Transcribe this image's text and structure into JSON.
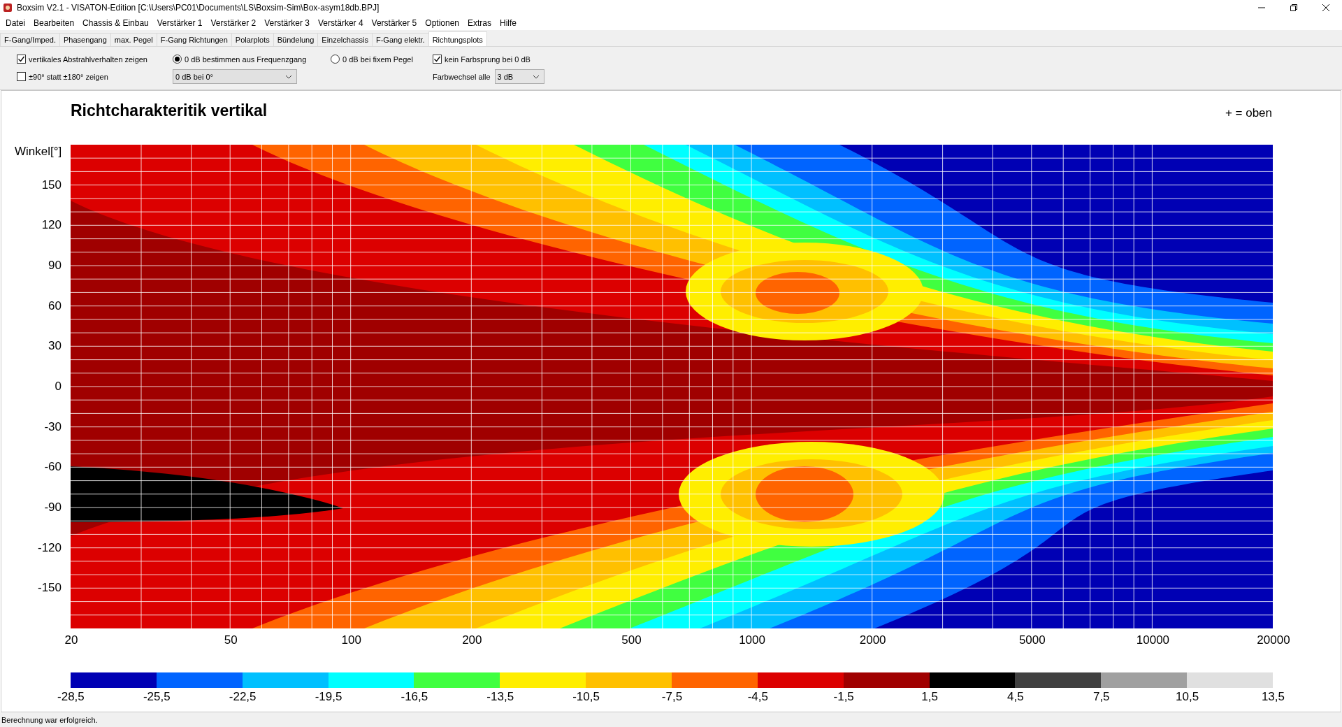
{
  "window": {
    "title": "Boxsim V2.1 - VISATON-Edition [C:\\Users\\PC01\\Documents\\LS\\Boxsim-Sim\\Box-asym18db.BPJ]"
  },
  "menu": [
    "Datei",
    "Bearbeiten",
    "Chassis & Einbau",
    "Verstärker 1",
    "Verstärker 2",
    "Verstärker 3",
    "Verstärker 4",
    "Verstärker 5",
    "Optionen",
    "Extras",
    "Hilfe"
  ],
  "tabs": [
    {
      "label": "F-Gang/Imped.",
      "selected": false
    },
    {
      "label": "Phasengang",
      "selected": false
    },
    {
      "label": "max. Pegel",
      "selected": false
    },
    {
      "label": "F-Gang Richtungen",
      "selected": false
    },
    {
      "label": "Polarplots",
      "selected": false
    },
    {
      "label": "Bündelung",
      "selected": false
    },
    {
      "label": "Einzelchassis",
      "selected": false
    },
    {
      "label": "F-Gang elektr.",
      "selected": false
    },
    {
      "label": "Richtungsplots",
      "selected": true
    }
  ],
  "options": [
    {
      "kind": "checkbox",
      "label": "vertikales Abstrahlverhalten zeigen",
      "checked": true
    },
    {
      "kind": "radio",
      "label": "0 dB bestimmen aus Frequenzgang",
      "selected": true
    },
    {
      "kind": "radio",
      "label": "0 dB bei fixem Pegel",
      "selected": false
    },
    {
      "kind": "checkbox",
      "label": "kein Farbsprung bei 0 dB",
      "checked": true
    },
    {
      "kind": "checkbox",
      "label": "±90° statt ±180° zeigen",
      "checked": false
    },
    {
      "kind": "dropdown",
      "value": "0 dB bei 0°"
    },
    {
      "kind": "empty"
    },
    {
      "kind": "labeled_dropdown",
      "label": "Farbwechsel  alle",
      "value": "3 dB"
    }
  ],
  "plot": {
    "title": "Richtcharakteritik vertikal",
    "orientation_note": "+ = oben",
    "y_axis_label": "Winkel[°]",
    "y_ticks": [
      "150",
      "120",
      "90",
      "60",
      "30",
      "0",
      "-30",
      "-60",
      "-90",
      "-120",
      "-150"
    ],
    "x_ticks": [
      "20",
      "50",
      "100",
      "200",
      "500",
      "1000",
      "2000",
      "5000",
      "10000",
      "20000"
    ]
  },
  "legend": {
    "swatches": [
      {
        "color": "#0000b4"
      },
      {
        "color": "#0064ff"
      },
      {
        "color": "#00c0ff"
      },
      {
        "color": "#00ffff"
      },
      {
        "color": "#40ff40"
      },
      {
        "color": "#ffee00"
      },
      {
        "color": "#ffc000"
      },
      {
        "color": "#ff6400"
      },
      {
        "color": "#dc0000"
      },
      {
        "color": "#a00000"
      },
      {
        "color": "#000000"
      },
      {
        "color": "#404040"
      },
      {
        "color": "#a0a0a0"
      },
      {
        "color": "#e0e0e0"
      }
    ],
    "labels": [
      "-28,5",
      "-25,5",
      "-22,5",
      "-19,5",
      "-16,5",
      "-13,5",
      "-10,5",
      "-7,5",
      "-4,5",
      "-1,5",
      "1,5",
      "4,5",
      "7,5",
      "10,5",
      "13,5"
    ]
  },
  "status_bar": "Berechnung war erfolgreich."
}
